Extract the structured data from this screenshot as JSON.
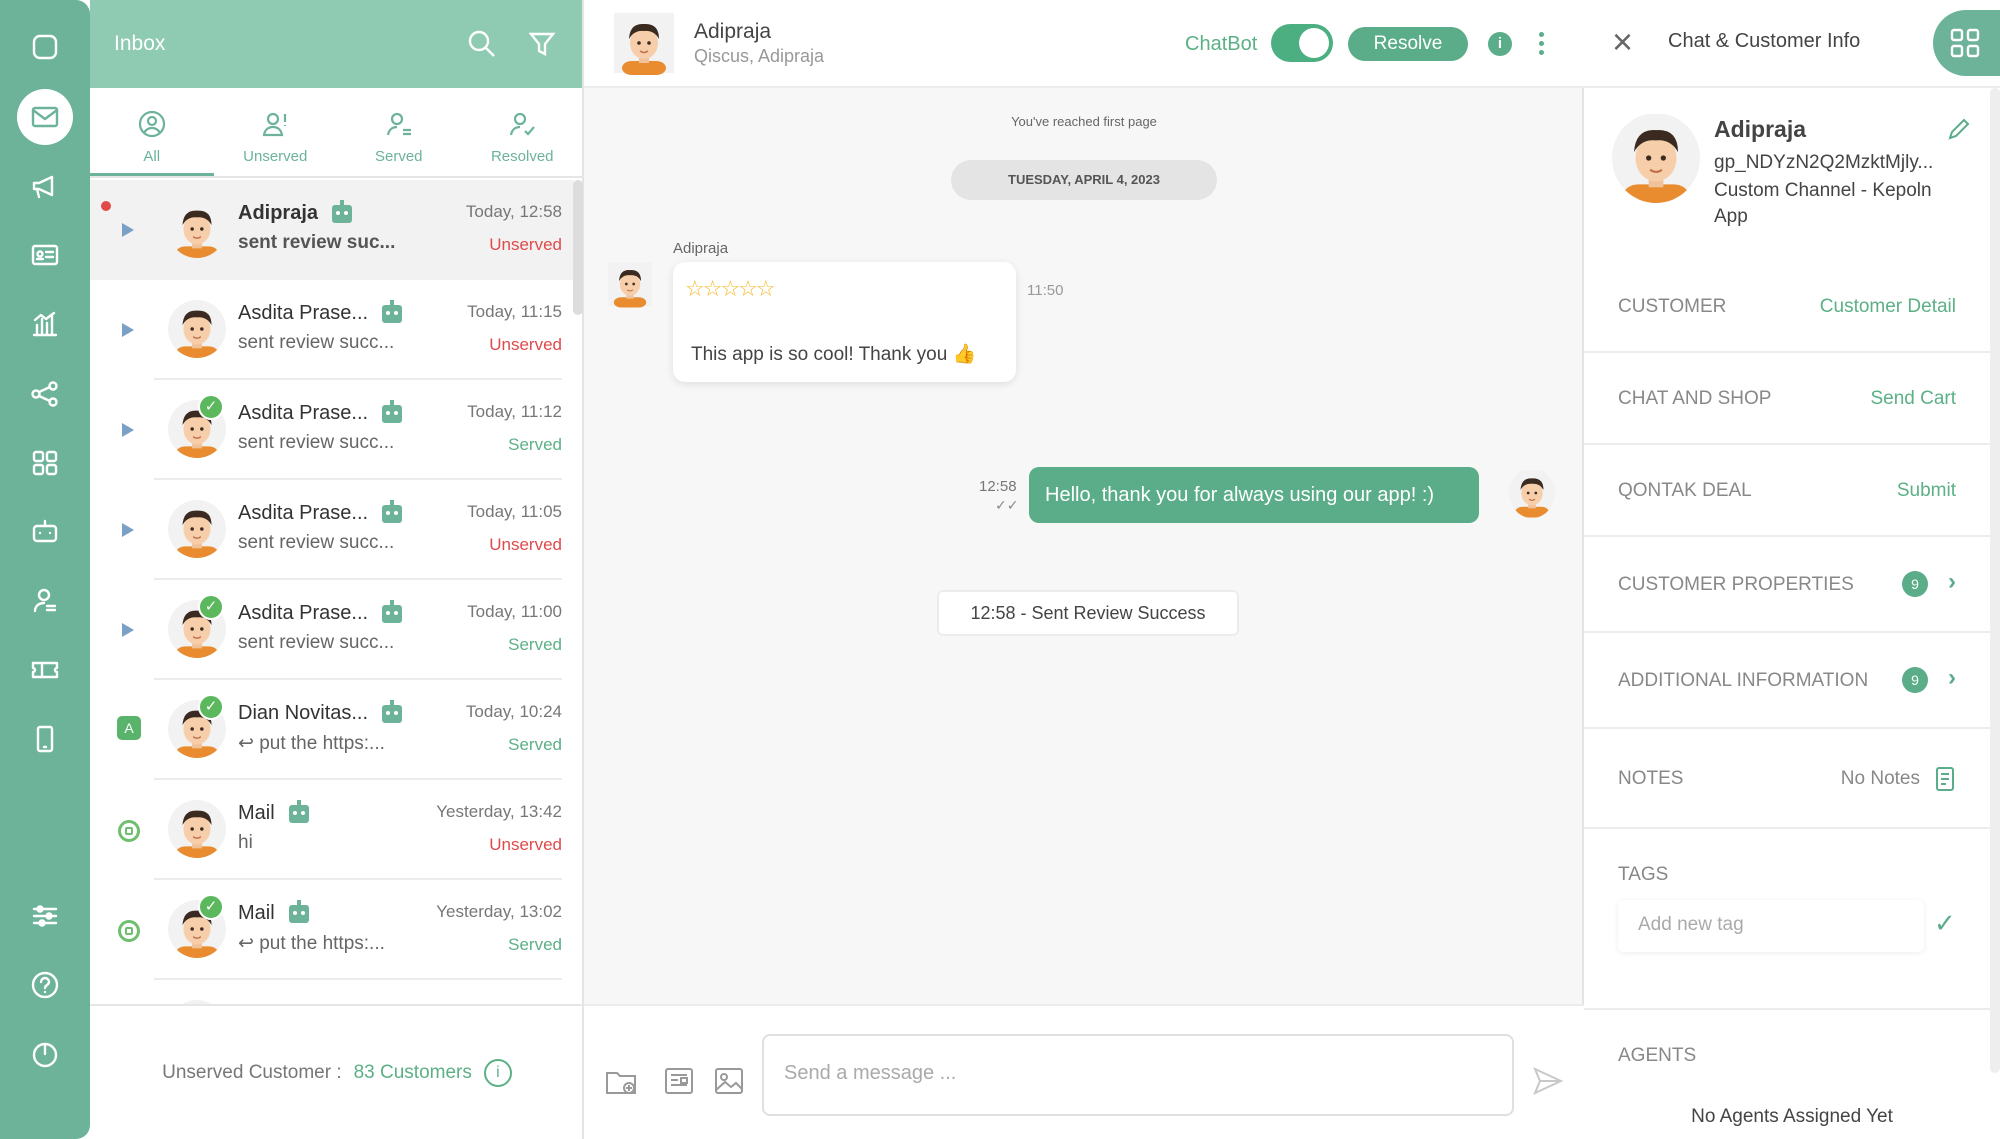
{
  "inbox": {
    "title": "Inbox",
    "tabs": [
      {
        "label": "All"
      },
      {
        "label": "Unserved"
      },
      {
        "label": "Served"
      },
      {
        "label": "Resolved"
      }
    ],
    "rows": [
      {
        "name": "Adipraja",
        "preview": "sent review suc...",
        "time": "Today, 12:58",
        "status": "Unserved",
        "bold": true,
        "source": "play"
      },
      {
        "name": "Asdita Prase...",
        "preview": "sent review succ...",
        "time": "Today, 11:15",
        "status": "Unserved",
        "source": "play"
      },
      {
        "name": "Asdita Prase...",
        "preview": "sent review succ...",
        "time": "Today, 11:12",
        "status": "Served",
        "source": "play"
      },
      {
        "name": "Asdita Prase...",
        "preview": "sent review succ...",
        "time": "Today, 11:05",
        "status": "Unserved",
        "source": "play"
      },
      {
        "name": "Asdita Prase...",
        "preview": "sent review succ...",
        "time": "Today, 11:00",
        "status": "Served",
        "source": "play"
      },
      {
        "name": "Dian Novitas...",
        "preview": "put the https:...",
        "time": "Today, 10:24",
        "status": "Served",
        "source": "app"
      },
      {
        "name": "Mail",
        "preview": "hi",
        "time": "Yesterday, 13:42",
        "status": "Unserved",
        "source": "ring"
      },
      {
        "name": "Mail",
        "preview": "put the https:...",
        "time": "Yesterday, 13:02",
        "status": "Served",
        "source": "ring"
      }
    ],
    "footer_label": "Unserved Customer :",
    "footer_count": "83 Customers"
  },
  "chat": {
    "name": "Adipraja",
    "sub": "Qiscus, Adipraja",
    "chatbot_label": "ChatBot",
    "resolve_label": "Resolve",
    "first_page": "You've reached first page",
    "date": "TUESDAY, APRIL 4, 2023",
    "sender": "Adipraja",
    "stars": "☆☆☆☆☆",
    "msg1": "This app is so cool! Thank you 👍",
    "time1": "11:50",
    "msg2": "Hello, thank you for always using our app! :)",
    "time2": "12:58",
    "system": "12:58 - Sent Review Success",
    "placeholder": "Send a message ..."
  },
  "side": {
    "title": "Chat & Customer Info",
    "name": "Adipraja",
    "id": "gp_NDYzN2Q2MzktMjly...",
    "channel": "Custom Channel - Kepoln App",
    "customer_k": "CUSTOMER",
    "customer_v": "Customer Detail",
    "shop_k": "CHAT AND SHOP",
    "shop_v": "Send Cart",
    "deal_k": "QONTAK DEAL",
    "deal_v": "Submit",
    "props_k": "CUSTOMER PROPERTIES",
    "props_n": "9",
    "addl_k": "ADDITIONAL INFORMATION",
    "addl_n": "9",
    "notes_k": "NOTES",
    "notes_v": "No Notes",
    "tags_k": "TAGS",
    "tag_placeholder": "Add new tag",
    "agents_k": "AGENTS",
    "agents_v": "No Agents Assigned Yet"
  },
  "colors": {
    "brand": "#6cb39a",
    "unserved": "#e04a4a",
    "served": "#5cb085"
  }
}
